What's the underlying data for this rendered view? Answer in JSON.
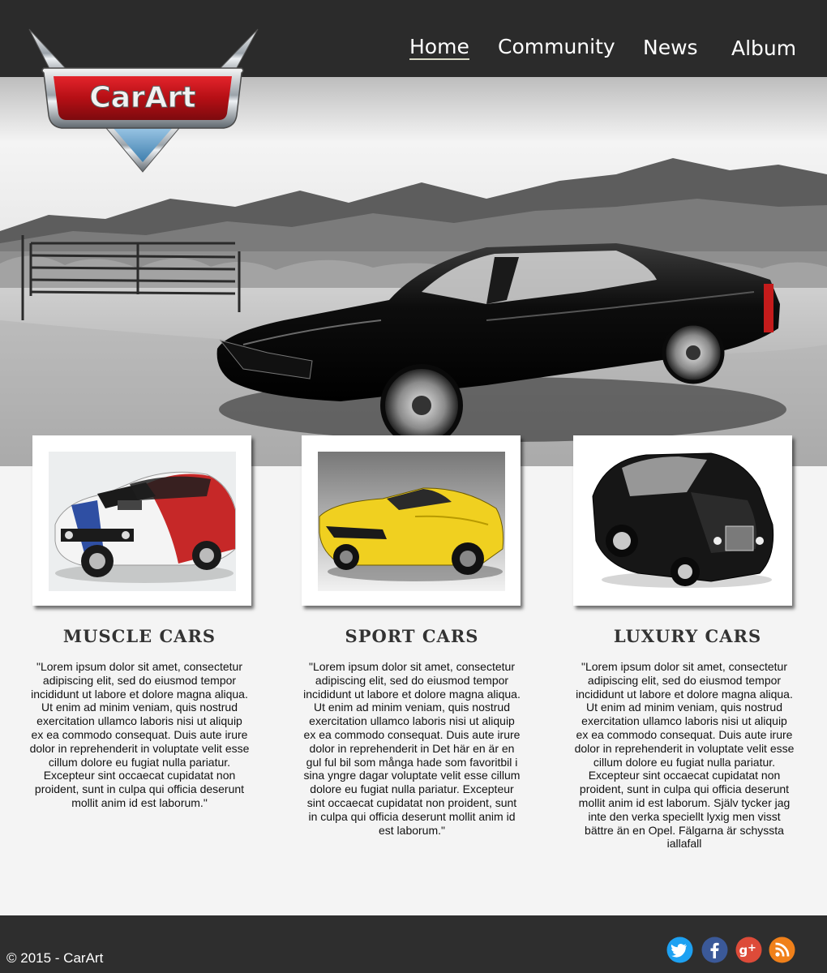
{
  "brand": {
    "logo_text": "CarArt"
  },
  "nav": {
    "items": [
      {
        "label": "Home",
        "active": true
      },
      {
        "label": "Community",
        "active": false
      },
      {
        "label": "News",
        "active": false
      },
      {
        "label": "Album",
        "active": false
      }
    ]
  },
  "cards": [
    {
      "title": "Muscle Cars",
      "text": "\"Lorem ipsum dolor sit amet, consectetur adipiscing elit, sed do eiusmod tempor incididunt ut labore et dolore magna aliqua. Ut enim ad minim veniam, quis nostrud exercitation ullamco laboris nisi ut aliquip ex ea commodo consequat. Duis aute irure dolor in reprehenderit in voluptate velit esse cillum dolore eu fugiat nulla pariatur. Excepteur sint occaecat cupidatat non proident, sunt in culpa qui officia deserunt mollit anim id est laborum.\""
    },
    {
      "title": "Sport Cars",
      "text": "\"Lorem ipsum dolor sit amet, consectetur adipiscing elit, sed do eiusmod tempor incididunt ut labore et dolore magna aliqua. Ut enim ad minim veniam, quis nostrud exercitation ullamco laboris nisi ut aliquip ex ea commodo consequat. Duis aute irure dolor in reprehenderit in Det här en är en gul ful bil som många hade som favoritbil i sina yngre dagar voluptate velit esse cillum dolore eu fugiat nulla pariatur. Excepteur sint occaecat cupidatat non proident, sunt in culpa qui officia deserunt mollit anim id est laborum.\""
    },
    {
      "title": "Luxury Cars",
      "text": "\"Lorem ipsum dolor sit amet, consectetur adipiscing elit, sed do eiusmod tempor incididunt ut labore et dolore magna aliqua. Ut enim ad minim veniam, quis nostrud exercitation ullamco laboris nisi ut aliquip ex ea commodo consequat. Duis aute irure dolor in reprehenderit in voluptate velit esse cillum dolore eu fugiat nulla pariatur. Excepteur sint occaecat cupidatat non proident, sunt in culpa qui officia deserunt mollit anim id est laborum. Själv tycker jag inte den verka speciellt lyxig men visst bättre än en Opel. Fälgarna är schyssta iallafall"
    }
  ],
  "footer": {
    "copyright": "© 2015 - CarArt",
    "social": [
      {
        "icon": "twitter-icon",
        "color": "#1da1f2"
      },
      {
        "icon": "facebook-icon",
        "color": "#3b5998"
      },
      {
        "icon": "google-plus-icon",
        "color": "#dd4b39"
      },
      {
        "icon": "rss-icon",
        "color": "#f0801a"
      }
    ]
  },
  "colors": {
    "header": "#2b2b2b",
    "footer": "#2e2e2e",
    "background": "#f4f4f4",
    "logo_red": "#c8161d"
  }
}
